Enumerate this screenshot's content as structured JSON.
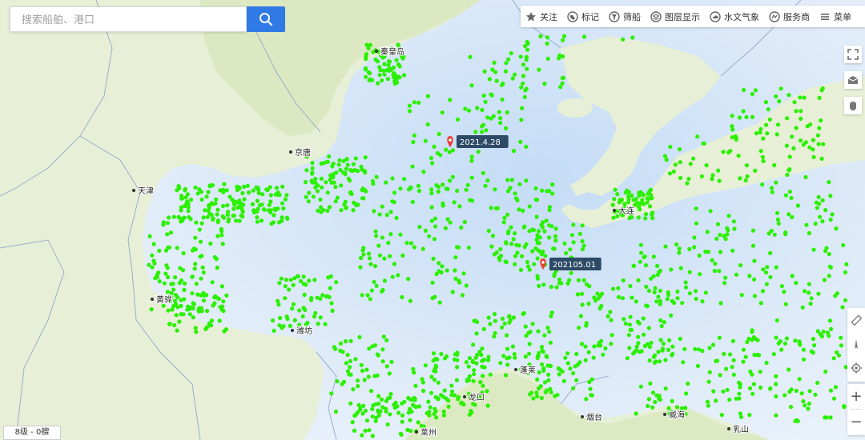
{
  "search": {
    "placeholder": "搜索船舶、港口"
  },
  "toolbar": {
    "items": [
      {
        "label": "关注",
        "icon": "star-icon"
      },
      {
        "label": "标记",
        "icon": "tag-icon"
      },
      {
        "label": "筛船",
        "icon": "filter-icon"
      },
      {
        "label": "图层显示",
        "icon": "layers-icon"
      },
      {
        "label": "水文气象",
        "icon": "weather-icon"
      },
      {
        "label": "服务商",
        "icon": "service-icon"
      },
      {
        "label": "菜单",
        "icon": "menu-icon"
      }
    ]
  },
  "map": {
    "cities": [
      {
        "name": "京唐"
      },
      {
        "name": "天津"
      },
      {
        "name": "黄骅"
      },
      {
        "name": "大连"
      },
      {
        "name": "龙口"
      },
      {
        "name": "烟台"
      },
      {
        "name": "威海"
      },
      {
        "name": "蓬莱"
      },
      {
        "name": "秦皇岛"
      },
      {
        "name": "莱州"
      },
      {
        "name": "潍坊"
      },
      {
        "name": "乳山"
      }
    ],
    "markers": [
      {
        "label": "2021.4.28"
      },
      {
        "label": "202105.01"
      }
    ],
    "ship_color": "#2bf000",
    "marker_color": "#e8423a",
    "water_color": "#cfe2f6",
    "land_color": "#e9f0d8"
  },
  "status": {
    "zoom_level": "8级 - 0艘"
  },
  "side_tools": [
    "fullscreen-icon",
    "box-icon",
    "hand-icon",
    "ruler-icon",
    "compass-icon",
    "locate-icon",
    "zoom-in-icon",
    "zoom-out-icon"
  ]
}
